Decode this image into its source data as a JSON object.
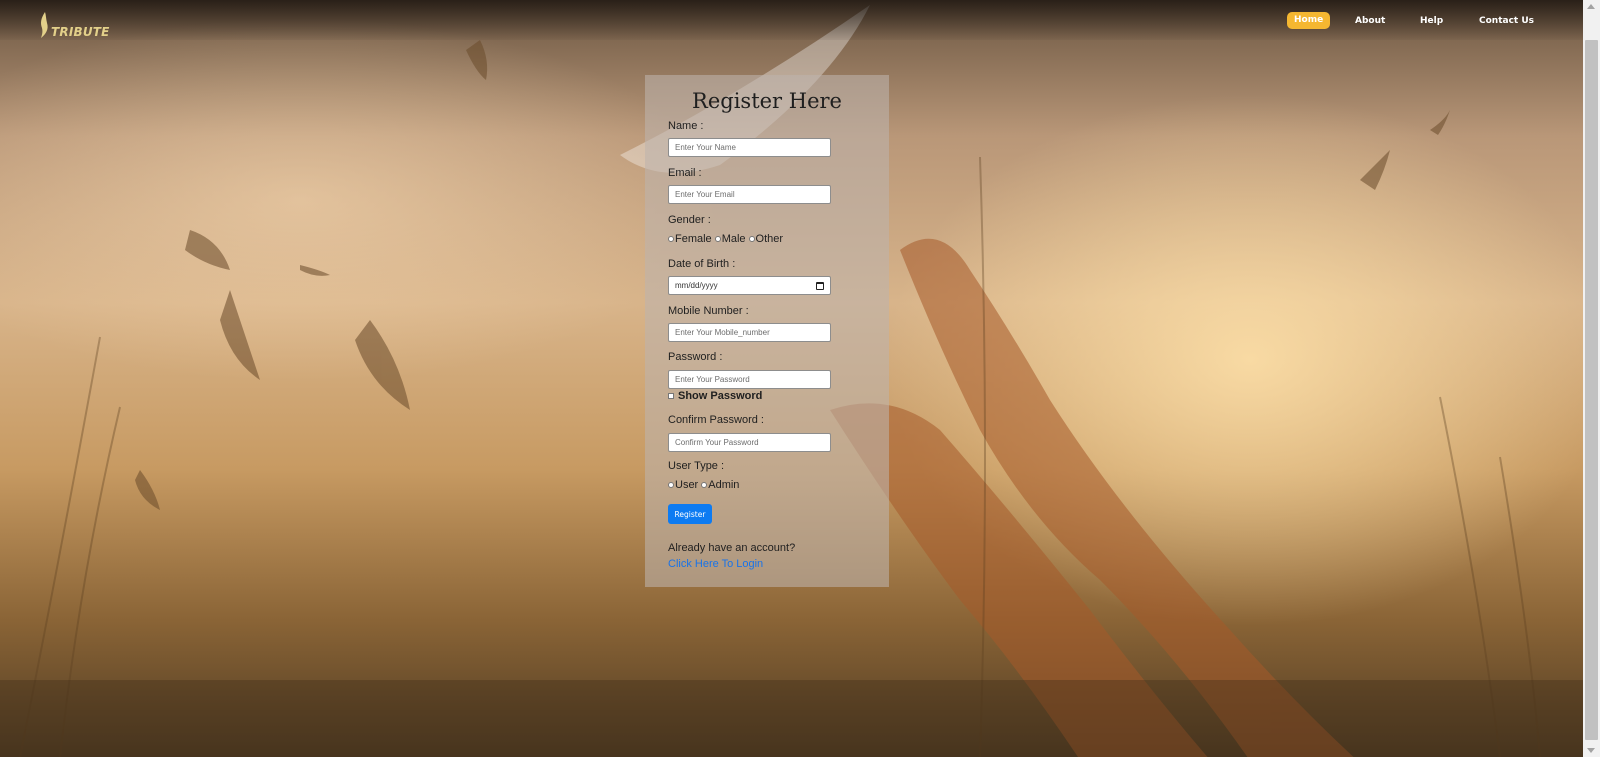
{
  "brand": {
    "name": "TRIBUTE"
  },
  "nav": {
    "items": [
      {
        "label": "Home",
        "active": true
      },
      {
        "label": "About",
        "active": false
      },
      {
        "label": "Help",
        "active": false
      },
      {
        "label": "Contact Us",
        "active": false
      }
    ],
    "active_color": "#f5b731"
  },
  "form": {
    "title": "Register Here",
    "name": {
      "label": "Name :",
      "placeholder": "Enter Your Name"
    },
    "email": {
      "label": "Email :",
      "placeholder": "Enter Your Email"
    },
    "gender": {
      "label": "Gender :",
      "options": [
        "Female",
        "Male",
        "Other"
      ]
    },
    "dob": {
      "label": "Date of Birth :",
      "placeholder": "mm/dd/yyyy"
    },
    "mobile": {
      "label": "Mobile Number :",
      "placeholder": "Enter Your Mobile_number"
    },
    "password": {
      "label": "Password :",
      "placeholder": "Enter Your Password",
      "show_label": "Show Password"
    },
    "confirm_password": {
      "label": "Confirm Password :",
      "placeholder": "Confirm Your Password"
    },
    "user_type": {
      "label": "User Type :",
      "options": [
        "User",
        "Admin"
      ]
    },
    "submit_label": "Register",
    "account_prompt": "Already have an account?",
    "login_link": "Click Here To Login",
    "button_color": "#0d7bf2",
    "link_color": "#1a73e8"
  }
}
